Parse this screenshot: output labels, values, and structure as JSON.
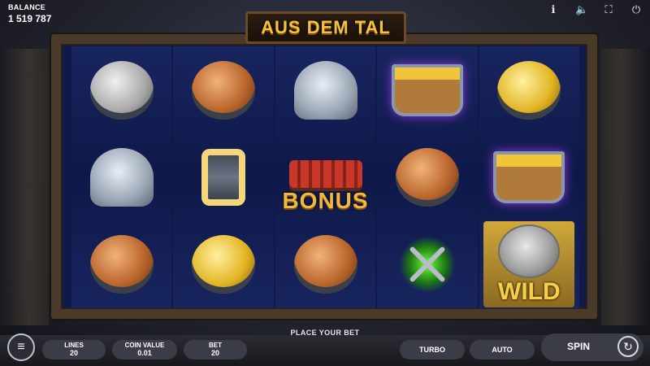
{
  "balance": {
    "label": "BALANCE",
    "value": "1 519 787"
  },
  "top_icons": [
    "info-icon",
    "volume-icon",
    "settings-icon",
    "power-icon"
  ],
  "logo": {
    "text": "AUS DEM TAL"
  },
  "reels": [
    [
      "silver-ore",
      "helmet",
      "copper-ore"
    ],
    [
      "copper-ore",
      "lantern",
      "gold-ore"
    ],
    [
      "helmet",
      "bonus",
      "copper-ore"
    ],
    [
      "gold-cart",
      "copper-ore",
      "pickaxes"
    ],
    [
      "gold-ore",
      "gold-cart",
      "wild"
    ]
  ],
  "symbols": {
    "bonus_text": "BONUS",
    "wild_text": "WILD"
  },
  "message": "PLACE YOUR BET",
  "controls": {
    "lines": {
      "label": "LINES",
      "value": "20"
    },
    "coin_value": {
      "label": "COIN VALUE",
      "value": "0.01"
    },
    "bet": {
      "label": "BET",
      "value": "20"
    },
    "turbo": "TURBO",
    "auto": "AUTO",
    "spin": "SPIN"
  }
}
